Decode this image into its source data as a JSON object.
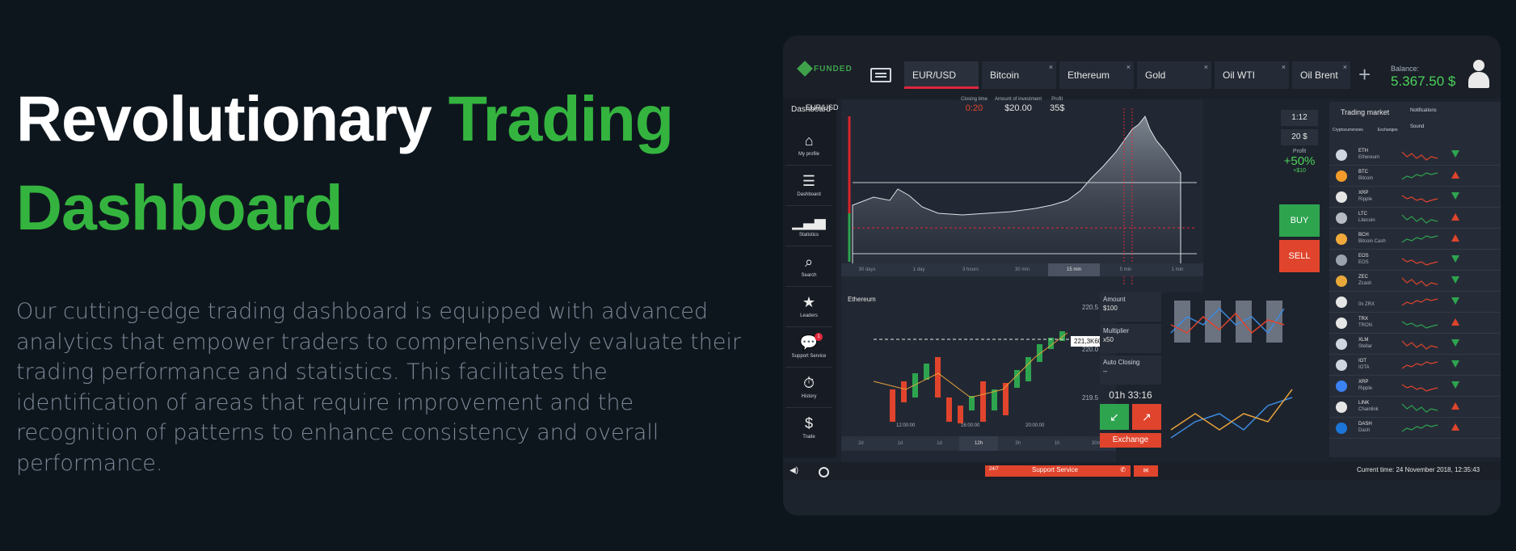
{
  "hero": {
    "title_part1": "Revolutionary ",
    "title_accent": "Trading Dashboard",
    "description": "Our cutting-edge trading dashboard is equipped with advanced analytics that empower traders to comprehensively evaluate their trading performance and statistics. This facilitates the identification of areas that require improvement and the recognition of patterns to enhance consistency and overall performance."
  },
  "colors": {
    "accent_green": "#34b43f",
    "background": "#0e161d",
    "buy_green": "#2ea44f",
    "sell_red": "#e0442c",
    "tab_indicator": "#e0263d"
  },
  "dashboard": {
    "logo": "FUNDED",
    "tabs": [
      {
        "label": "EUR/USD",
        "close": "×",
        "active": true
      },
      {
        "label": "Bitcoin",
        "close": "×"
      },
      {
        "label": "Ethereum",
        "close": "×"
      },
      {
        "label": "Gold",
        "close": "×"
      },
      {
        "label": "Oil WTI",
        "close": "×"
      },
      {
        "label": "Oil Brent",
        "close": "×"
      }
    ],
    "add_tab": "+",
    "balance_label": "Balance:",
    "balance_value": "5.367.50 $",
    "sidebar": {
      "header": "Dashboard",
      "items": [
        {
          "label": "My profile",
          "icon": "home-icon"
        },
        {
          "label": "Dashboard",
          "icon": "list-icon"
        },
        {
          "label": "Statistics",
          "icon": "bar-chart-icon"
        },
        {
          "label": "Search",
          "icon": "search-icon"
        },
        {
          "label": "Leaders",
          "icon": "star-icon"
        },
        {
          "label": "Support Service",
          "icon": "chat-icon",
          "badge": "1"
        },
        {
          "label": "History",
          "icon": "stopwatch-icon"
        },
        {
          "label": "Trade",
          "icon": "dollar-icon"
        }
      ]
    },
    "main_chart": {
      "pair": "EUR/USD",
      "closing_label": "Closing time",
      "closing_value": "0:20",
      "investment_label": "Amount of investment",
      "investment_value": "$20.00",
      "profit_label": "Profit",
      "profit_value": "35$",
      "ranges": [
        "30 days",
        "1 day",
        "3 hours",
        "30 min",
        "15 min",
        "5 min",
        "1 min"
      ]
    },
    "trade_controls": {
      "time": "1:12",
      "amount": "20 $",
      "profit_label": "Profit",
      "profit_percent": "+50%",
      "profit_amount": "+$10",
      "buy_label": "BUY",
      "sell_label": "SELL"
    },
    "second_chart": {
      "pair": "Ethereum",
      "price_tag": "221,3K60",
      "price_axis": [
        "220.5",
        "220.0",
        "219.5"
      ],
      "time_axis": [
        "12:00:00",
        "16:00:00",
        "20:00:00"
      ],
      "timeframes": [
        "2d",
        "1d",
        "1d",
        "12h",
        "3h",
        "1h",
        "30m"
      ]
    },
    "exchange": {
      "amount_label": "Amount",
      "amount_value": "$100",
      "multiplier_label": "Multiplier",
      "multiplier_value": "x50",
      "auto_label": "Auto Closing",
      "auto_value": "--",
      "timer": "01h 33:16",
      "exchange_label": "Exchange"
    },
    "market": {
      "title": "Trading market",
      "notifications": "Notifications",
      "sound": "Sound",
      "tabs": [
        "Cryptocurrencies",
        "Exchanges"
      ],
      "coins": [
        {
          "sym": "ETH",
          "name": "Ethereum",
          "color": "#cfd6df",
          "dir": "up"
        },
        {
          "sym": "BTC",
          "name": "Bitcoin",
          "color": "#f29b2b",
          "dir": "down"
        },
        {
          "sym": "XRP",
          "name": "Ripple",
          "color": "#e6e6e6",
          "dir": "up"
        },
        {
          "sym": "LTC",
          "name": "Litecoin",
          "color": "#b7bcc4",
          "dir": "down"
        },
        {
          "sym": "BCH",
          "name": "Bitcoin Cash",
          "color": "#f2a93b",
          "dir": "down"
        },
        {
          "sym": "EOS",
          "name": "EOS",
          "color": "#9aa3ad",
          "dir": "up"
        },
        {
          "sym": "ZEC",
          "name": "Zcash",
          "color": "#e9a93a",
          "dir": "up"
        },
        {
          "sym": "",
          "name": "0x ZRX",
          "color": "#e6e6e6",
          "dir": "up"
        },
        {
          "sym": "TRX",
          "name": "TRON",
          "color": "#e6e6e6",
          "dir": "down"
        },
        {
          "sym": "XLM",
          "name": "Stellar",
          "color": "#cfd6df",
          "dir": "up"
        },
        {
          "sym": "IOT",
          "name": "IOTA",
          "color": "#cfd6df",
          "dir": "up"
        },
        {
          "sym": "XRP",
          "name": "Ripple",
          "color": "#3b82f6",
          "dir": "up"
        },
        {
          "sym": "LINK",
          "name": "Chainlink",
          "color": "#e6e6e6",
          "dir": "down"
        },
        {
          "sym": "DASH",
          "name": "Dash",
          "color": "#1c75d8",
          "dir": "down"
        }
      ]
    },
    "status": {
      "support_hours": "24/7",
      "support_label": "Support Service",
      "current_time": "Current time: 24 November 2018, 12:35:43"
    }
  }
}
